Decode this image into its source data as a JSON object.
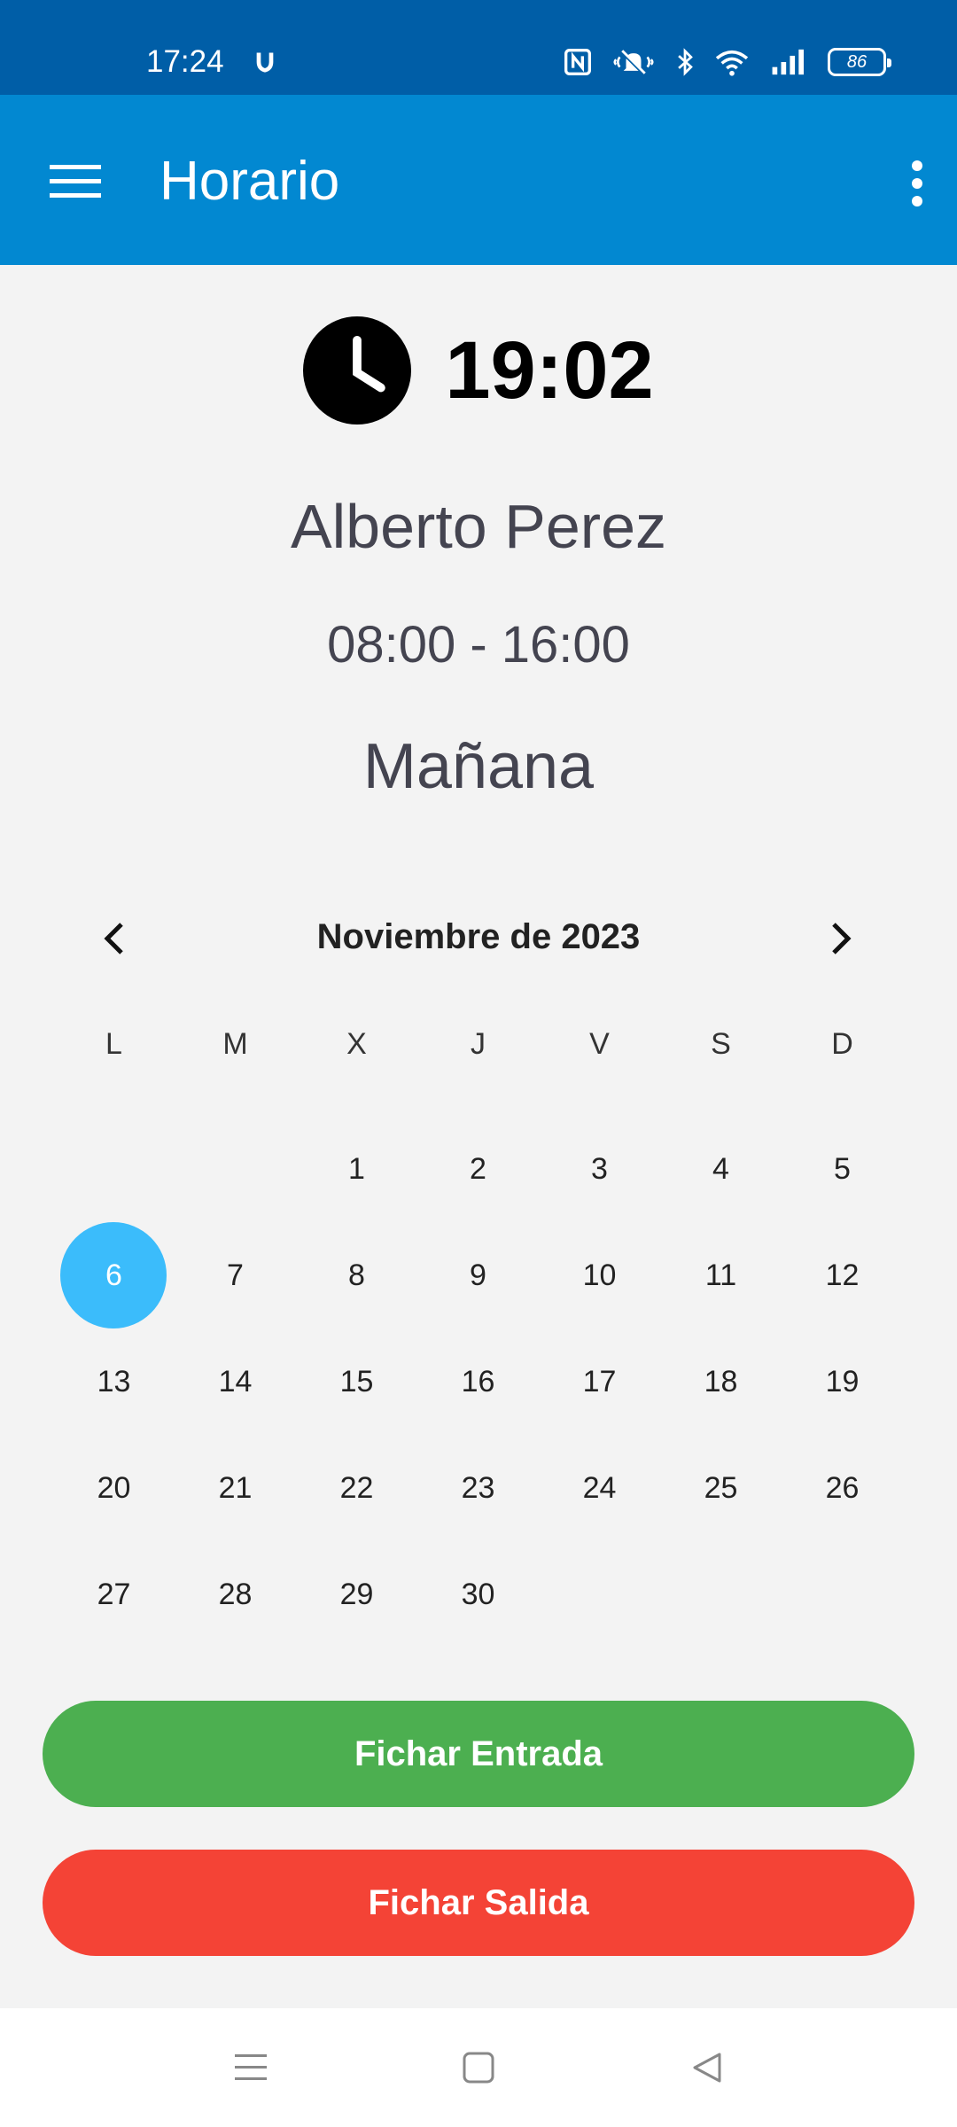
{
  "status_bar": {
    "time": "17:24",
    "battery": "86",
    "icons": [
      "shield-icon",
      "nfc-icon",
      "bell-muted-icon",
      "bluetooth-icon",
      "wifi-icon",
      "signal-icon",
      "battery-icon"
    ]
  },
  "app_bar": {
    "title": "Horario",
    "menu_icon": "hamburger-menu-icon",
    "more_icon": "more-vertical-icon",
    "background": "#0288d1"
  },
  "schedule": {
    "current_time": "19:02",
    "employee_name": "Alberto Perez",
    "hours": "08:00 - 16:00",
    "shift": "Mañana"
  },
  "calendar": {
    "month_label": "Noviembre de 2023",
    "weekdays": [
      "L",
      "M",
      "X",
      "J",
      "V",
      "S",
      "D"
    ],
    "weeks": [
      [
        "",
        "",
        "1",
        "2",
        "3",
        "4",
        "5"
      ],
      [
        "6",
        "7",
        "8",
        "9",
        "10",
        "11",
        "12"
      ],
      [
        "13",
        "14",
        "15",
        "16",
        "17",
        "18",
        "19"
      ],
      [
        "20",
        "21",
        "22",
        "23",
        "24",
        "25",
        "26"
      ],
      [
        "27",
        "28",
        "29",
        "30",
        "",
        "",
        ""
      ]
    ],
    "selected_day": "6",
    "selected_color": "#3bbcfb"
  },
  "actions": {
    "check_in": "Fichar Entrada",
    "check_out": "Fichar Salida",
    "check_in_color": "#4caf50",
    "check_out_color": "#f44336"
  },
  "nav_bar": {
    "icons": [
      "recents-icon",
      "home-icon",
      "back-icon"
    ]
  }
}
